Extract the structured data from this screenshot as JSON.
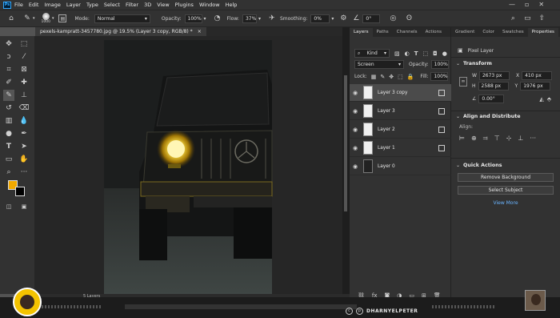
{
  "menu": {
    "app_icon": "Ps",
    "items": [
      "File",
      "Edit",
      "Image",
      "Layer",
      "Type",
      "Select",
      "Filter",
      "3D",
      "View",
      "Plugins",
      "Window",
      "Help"
    ]
  },
  "options": {
    "brush_size": "1000",
    "mode_label": "Mode:",
    "mode_value": "Normal",
    "opacity_label": "Opacity:",
    "opacity_value": "100%",
    "flow_label": "Flow:",
    "flow_value": "37%",
    "smoothing_label": "Smoothing:",
    "smoothing_value": "0%",
    "angle_value": "0°"
  },
  "document": {
    "tab_title": "pexels-kampratt-3457780.jpg @ 19.5% (Layer 3 copy, RGB/8) *",
    "close": "×"
  },
  "layers_panel": {
    "tabs": [
      "Layers",
      "Paths",
      "Channels",
      "Actions"
    ],
    "filter_label": "Kind",
    "blend_mode": "Screen",
    "opacity_label": "Opacity:",
    "opacity_value": "100%",
    "lock_label": "Lock:",
    "fill_label": "Fill:",
    "fill_value": "100%",
    "layers": [
      {
        "name": "Layer 3 copy",
        "selected": true
      },
      {
        "name": "Layer 3",
        "selected": false
      },
      {
        "name": "Layer 2",
        "selected": false
      },
      {
        "name": "Layer 1",
        "selected": false
      },
      {
        "name": "Layer 0",
        "selected": false
      }
    ]
  },
  "properties_panel": {
    "tabs": [
      "Gradient",
      "Color",
      "Swatches",
      "Properties"
    ],
    "type": "Pixel Layer",
    "transform_title": "Transform",
    "w_label": "W",
    "w_value": "2673 px",
    "h_label": "H",
    "h_value": "2588 px",
    "x_label": "X",
    "x_value": "410 px",
    "y_label": "Y",
    "y_value": "1976 px",
    "angle_value": "0.00°",
    "align_title": "Align and Distribute",
    "align_label": "Align:",
    "quick_title": "Quick Actions",
    "remove_bg": "Remove Background",
    "select_subject": "Select Subject",
    "view_more": "View More"
  },
  "status": {
    "layers_count": "5 Layers"
  },
  "branding": {
    "name": "DHARNYELPETER"
  },
  "colors": {
    "foreground": "#f2a900",
    "background": "#000000",
    "accent": "#31a8ff",
    "brand_yellow": "#f4c300"
  }
}
